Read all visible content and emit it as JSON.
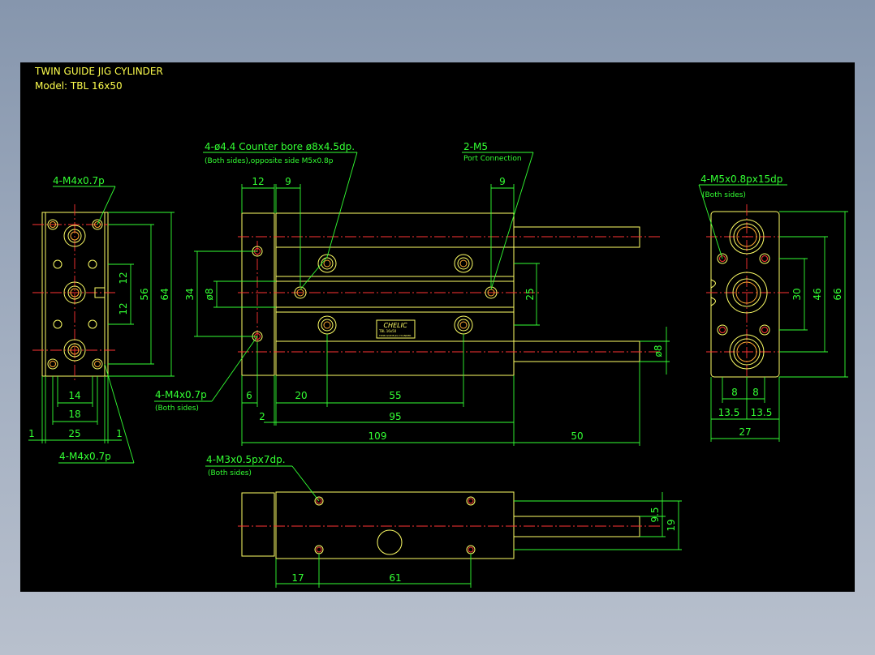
{
  "title": {
    "line1": "TWIN GUIDE JIG CYLINDER",
    "line2": "Model:  TBL 16x50"
  },
  "colors": {
    "outline": "#ffff66",
    "dimension": "#33ff33",
    "centerline": "#ff3333",
    "canvas": "#000000"
  },
  "notes": {
    "front_counterbore": "4-ø4.4  Counter bore  ø8x4.5dp.",
    "front_counterbore_sub": "(Both sides),opposite side  M5x0.8p",
    "port": "2-M5",
    "port_sub": "Port Connection",
    "left_top": "4-M4x0.7p",
    "left_bottom": "4-M4x0.7p",
    "front_tap": "4-M4x0.7p",
    "front_tap_sub": "(Both sides)",
    "right_tap": "4-M5x0.8px15dp",
    "right_tap_sub": "(Both sides)",
    "bottom_tap": "4-M3x0.5px7dp.",
    "bottom_tap_sub": "(Both sides)",
    "badge_brand": "CHELIC",
    "badge_line1": "TBL 16x50",
    "badge_line2": "TWIN GUIDE JIG CYLINDER"
  },
  "dims": {
    "left": {
      "h12a": "12",
      "h12b": "12",
      "h56": "56",
      "h64": "64",
      "w14": "14",
      "w18": "18",
      "w25": "25",
      "w1a": "1",
      "w1b": "1"
    },
    "front": {
      "top12": "12",
      "top9a": "9",
      "top9b": "9",
      "h34": "34",
      "d8": "ø8",
      "h25": "25",
      "w6": "6",
      "w20": "20",
      "w55": "55",
      "w2": "2",
      "w95": "95",
      "w109": "109",
      "w50": "50",
      "rod_d8": "ø8"
    },
    "right": {
      "h30": "30",
      "h46": "46",
      "h66": "66",
      "w8a": "8",
      "w8b": "8",
      "w13a": "13.5",
      "w13b": "13.5",
      "w27": "27"
    },
    "bottom": {
      "w17": "17",
      "w61": "61",
      "h95": "9.5",
      "h19": "19"
    }
  }
}
